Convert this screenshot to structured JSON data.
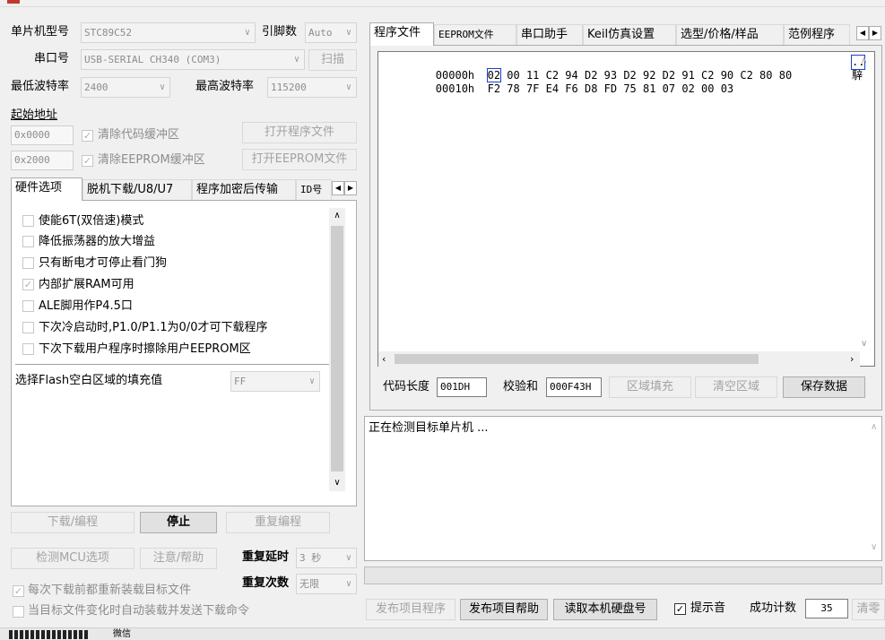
{
  "top": {
    "mcu_label": "单片机型号",
    "mcu_value": "STC89C52",
    "pins_label": "引脚数",
    "pins_value": "Auto",
    "port_label": "串口号",
    "port_value": "USB-SERIAL CH340 (COM3)",
    "scan_button": "扫描",
    "min_baud_label": "最低波特率",
    "min_baud_value": "2400",
    "max_baud_label": "最高波特率",
    "max_baud_value": "115200",
    "start_addr_label": "起始地址",
    "code_addr": "0x0000",
    "clear_code_label": "清除代码缓冲区",
    "open_program_button": "打开程序文件",
    "eeprom_addr": "0x2000",
    "clear_eeprom_label": "清除EEPROM缓冲区",
    "open_eeprom_button": "打开EEPROM文件"
  },
  "left_tabs": [
    "硬件选项",
    "脱机下载/U8/U7",
    "程序加密后传输",
    "ID号"
  ],
  "hw_options": [
    {
      "label": "使能6T(双倍速)模式",
      "checked": false
    },
    {
      "label": "降低振荡器的放大增益",
      "checked": false
    },
    {
      "label": "只有断电才可停止看门狗",
      "checked": false
    },
    {
      "label": "内部扩展RAM可用",
      "checked": true
    },
    {
      "label": "ALE脚用作P4.5口",
      "checked": false
    },
    {
      "label": "下次冷启动时,P1.0/P1.1为0/0才可下载程序",
      "checked": false
    },
    {
      "label": "下次下载用户程序时擦除用户EEPROM区",
      "checked": false
    }
  ],
  "fill": {
    "label": "选择Flash空白区域的填充值",
    "value": "FF"
  },
  "bottom_left": {
    "download_button": "下载/编程",
    "stop_button": "停止",
    "reprogram_button": "重复编程",
    "detect_button": "检测MCU选项",
    "help_button": "注意/帮助",
    "delay_label": "重复延时",
    "delay_value": "3 秒",
    "count_label": "重复次数",
    "count_value": "无限",
    "reload_label": "每次下载前都重新装载目标文件",
    "reload_checked": true,
    "auto_label": "当目标文件变化时自动装载并发送下载命令",
    "auto_checked": false
  },
  "right_tabs": [
    "程序文件",
    "EEPROM文件",
    "串口助手",
    "Keil仿真设置",
    "选型/价格/样品",
    "范例程序"
  ],
  "hex": {
    "rows": [
      {
        "addr": "00000h",
        "first": "02",
        "rest": " 00 11 C2 94 D2 93 D2 92 D2 91 C2 90 C2 80 80",
        "ascii": ".."
      },
      {
        "addr": "00010h",
        "first": "",
        "rest": "F2 78 7F E4 F6 D8 FD 75 81 07 02 00 03",
        "ascii": "騂"
      }
    ]
  },
  "code_bar": {
    "length_label": "代码长度",
    "length_value": "001DH",
    "checksum_label": "校验和",
    "checksum_value": "000F43H",
    "fill_button": "区域填充",
    "clear_button": "清空区域",
    "save_button": "保存数据"
  },
  "log": {
    "text": "正在检测目标单片机 ..."
  },
  "footer": {
    "publish_button": "发布项目程序",
    "publish_help_button": "发布项目帮助",
    "read_disk_button": "读取本机硬盘号",
    "beep_label": "提示音",
    "beep_checked": true,
    "success_label": "成功计数",
    "success_value": "35",
    "reset_button": "清零"
  },
  "taskbar": {
    "app_label": "微信"
  }
}
